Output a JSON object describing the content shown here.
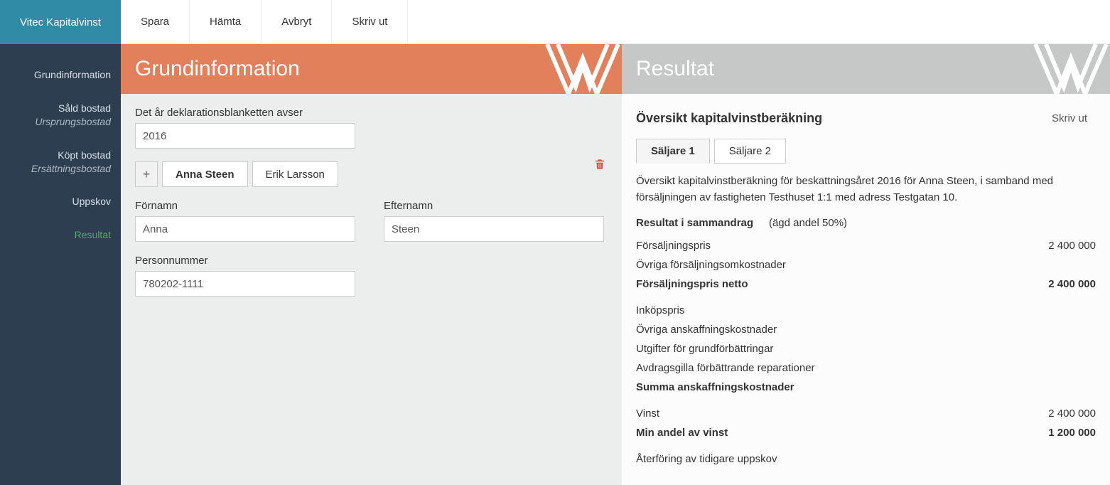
{
  "brand": "Vitec Kapitalvinst",
  "toolbar": {
    "save": "Spara",
    "load": "Hämta",
    "cancel": "Avbryt",
    "print": "Skriv ut"
  },
  "sidebar": {
    "items": [
      {
        "label": "Grundinformation",
        "sub": ""
      },
      {
        "label": "Såld bostad",
        "sub": "Ursprungsbostad"
      },
      {
        "label": "Köpt bostad",
        "sub": "Ersättningsbostad"
      },
      {
        "label": "Uppskov",
        "sub": ""
      },
      {
        "label": "Resultat",
        "sub": ""
      }
    ]
  },
  "left": {
    "title": "Grundinformation",
    "year_label": "Det år deklarationsblanketten avser",
    "year_value": "2016",
    "persons": [
      {
        "name": "Anna Steen"
      },
      {
        "name": "Erik Larsson"
      }
    ],
    "fornamn_label": "Förnamn",
    "fornamn_value": "Anna",
    "efternamn_label": "Efternamn",
    "efternamn_value": "Steen",
    "pnr_label": "Personnummer",
    "pnr_value": "780202-1111"
  },
  "right": {
    "title": "Resultat",
    "overview_title": "Översikt kapitalvinstberäkning",
    "print": "Skriv ut",
    "tabs": [
      {
        "label": "Säljare 1"
      },
      {
        "label": "Säljare 2"
      }
    ],
    "desc": "Översikt kapitalvinstberäkning för beskattningsåret 2016 för Anna Steen, i samband med försäljningen av fastigheten Testhuset 1:1 med adress Testgatan 10.",
    "summary_title": "Resultat i sammandrag",
    "summary_note": "(ägd andel 50%)",
    "lines": [
      {
        "label": "Försäljningspris",
        "value": "2 400 000",
        "bold": false
      },
      {
        "label": "Övriga försäljningsomkostnader",
        "value": "",
        "bold": false
      },
      {
        "label": "Försäljningspris netto",
        "value": "2 400 000",
        "bold": true
      },
      {
        "gap": true
      },
      {
        "label": "Inköpspris",
        "value": "",
        "bold": false
      },
      {
        "label": "Övriga anskaffningskostnader",
        "value": "",
        "bold": false
      },
      {
        "label": "Utgifter för grundförbättringar",
        "value": "",
        "bold": false
      },
      {
        "label": "Avdragsgilla förbättrande reparationer",
        "value": "",
        "bold": false
      },
      {
        "label": "Summa anskaffningskostnader",
        "value": "",
        "bold": true
      },
      {
        "gap": true
      },
      {
        "label": "Vinst",
        "value": "2 400 000",
        "bold": false
      },
      {
        "label": "Min andel av vinst",
        "value": "1 200 000",
        "bold": true
      },
      {
        "gap": true
      },
      {
        "label": "Återföring av tidigare uppskov",
        "value": "",
        "bold": false
      }
    ]
  }
}
